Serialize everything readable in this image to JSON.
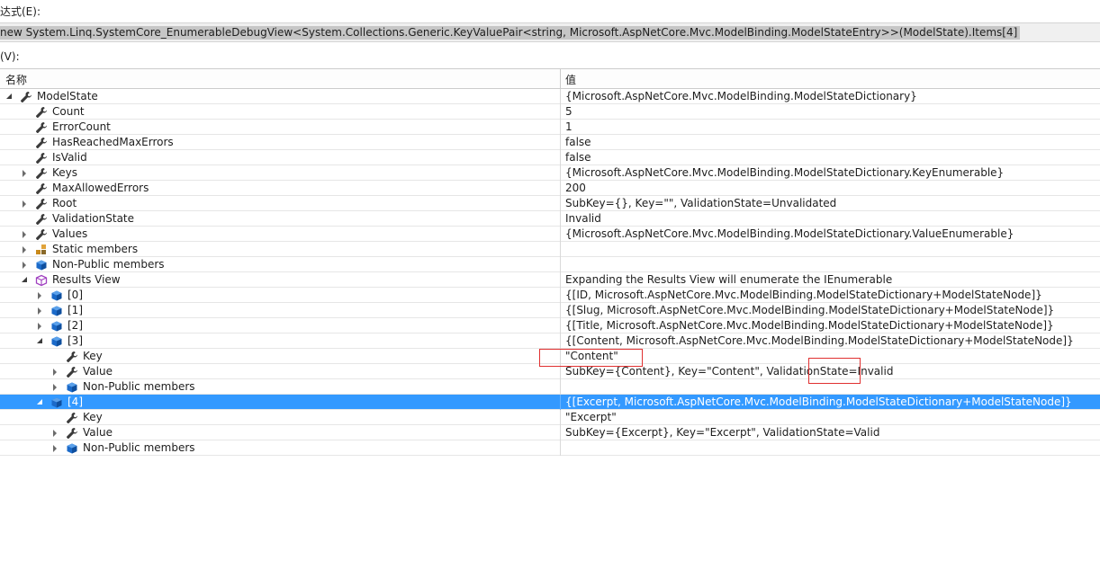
{
  "expression": {
    "label": "达式(E):",
    "text": "new System.Linq.SystemCore_EnumerableDebugView<System.Collections.Generic.KeyValuePair<string, Microsoft.AspNetCore.Mvc.ModelBinding.ModelStateEntry>>(ModelState).Items[4]"
  },
  "value_label": "(V):",
  "columns": {
    "name": "名称",
    "value": "值"
  },
  "rows": [
    {
      "name": "ModelState",
      "value": "{Microsoft.AspNetCore.Mvc.ModelBinding.ModelStateDictionary}",
      "expander": "open",
      "icon": "wrench-icon",
      "level": 0
    },
    {
      "name": "Count",
      "value": "5",
      "expander": "none",
      "icon": "wrench-icon",
      "level": 1
    },
    {
      "name": "ErrorCount",
      "value": "1",
      "expander": "none",
      "icon": "wrench-icon",
      "level": 1
    },
    {
      "name": "HasReachedMaxErrors",
      "value": "false",
      "expander": "none",
      "icon": "wrench-icon",
      "level": 1
    },
    {
      "name": "IsValid",
      "value": "false",
      "expander": "none",
      "icon": "wrench-icon",
      "level": 1
    },
    {
      "name": "Keys",
      "value": "{Microsoft.AspNetCore.Mvc.ModelBinding.ModelStateDictionary.KeyEnumerable}",
      "expander": "closed",
      "icon": "wrench-icon",
      "level": 1
    },
    {
      "name": "MaxAllowedErrors",
      "value": "200",
      "expander": "none",
      "icon": "wrench-icon",
      "level": 1
    },
    {
      "name": "Root",
      "value": "SubKey={}, Key=\"\", ValidationState=Unvalidated",
      "expander": "closed",
      "icon": "wrench-icon",
      "level": 1
    },
    {
      "name": "ValidationState",
      "value": "Invalid",
      "expander": "none",
      "icon": "wrench-icon",
      "level": 1
    },
    {
      "name": "Values",
      "value": "{Microsoft.AspNetCore.Mvc.ModelBinding.ModelStateDictionary.ValueEnumerable}",
      "expander": "closed",
      "icon": "wrench-icon",
      "level": 1
    },
    {
      "name": "Static members",
      "value": "",
      "expander": "closed",
      "icon": "static-members-icon",
      "level": 1
    },
    {
      "name": "Non-Public members",
      "value": "",
      "expander": "closed",
      "icon": "cube-icon",
      "level": 1
    },
    {
      "name": "Results View",
      "value": "Expanding the Results View will enumerate the IEnumerable",
      "expander": "open",
      "icon": "results-view-icon",
      "level": 1
    },
    {
      "name": "[0]",
      "value": "{[ID, Microsoft.AspNetCore.Mvc.ModelBinding.ModelStateDictionary+ModelStateNode]}",
      "expander": "closed",
      "icon": "cube-icon",
      "level": 2
    },
    {
      "name": "[1]",
      "value": "{[Slug, Microsoft.AspNetCore.Mvc.ModelBinding.ModelStateDictionary+ModelStateNode]}",
      "expander": "closed",
      "icon": "cube-icon",
      "level": 2
    },
    {
      "name": "[2]",
      "value": "{[Title, Microsoft.AspNetCore.Mvc.ModelBinding.ModelStateDictionary+ModelStateNode]}",
      "expander": "closed",
      "icon": "cube-icon",
      "level": 2
    },
    {
      "name": "[3]",
      "value": "{[Content, Microsoft.AspNetCore.Mvc.ModelBinding.ModelStateDictionary+ModelStateNode]}",
      "expander": "open",
      "icon": "cube-icon",
      "level": 2
    },
    {
      "name": "Key",
      "value": "\"Content\"",
      "expander": "none",
      "icon": "wrench-icon",
      "level": 3
    },
    {
      "name": "Value",
      "value": "SubKey={Content}, Key=\"Content\", ValidationState=Invalid",
      "expander": "closed",
      "icon": "wrench-icon",
      "level": 3
    },
    {
      "name": "Non-Public members",
      "value": "",
      "expander": "closed",
      "icon": "cube-icon",
      "level": 3
    },
    {
      "name": "[4]",
      "value": "{[Excerpt, Microsoft.AspNetCore.Mvc.ModelBinding.ModelStateDictionary+ModelStateNode]}",
      "expander": "open",
      "icon": "cube-icon",
      "level": 2,
      "selected": true
    },
    {
      "name": "Key",
      "value": "\"Excerpt\"",
      "expander": "none",
      "icon": "wrench-icon",
      "level": 3
    },
    {
      "name": "Value",
      "value": "SubKey={Excerpt}, Key=\"Excerpt\", ValidationState=Valid",
      "expander": "closed",
      "icon": "wrench-icon",
      "level": 3
    },
    {
      "name": "Non-Public members",
      "value": "",
      "expander": "closed",
      "icon": "cube-icon",
      "level": 3
    }
  ],
  "colors": {
    "selection": "#3399ff",
    "highlight_box": "#e03030",
    "icon_blue": "#1b6ac9"
  }
}
